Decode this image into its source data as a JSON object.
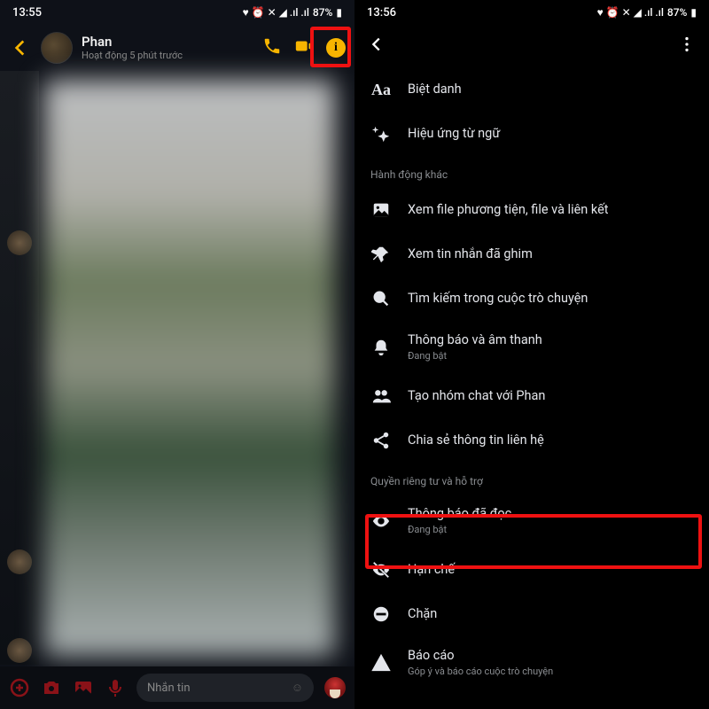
{
  "left": {
    "status_time": "13:55",
    "battery": "87%",
    "contact_name": "Phan",
    "last_active": "Hoạt động 5 phút trước",
    "compose_placeholder": "Nhắn tin"
  },
  "right": {
    "status_time": "13:56",
    "battery": "87%",
    "items_top": [
      {
        "icon": "aa",
        "label": "Biệt danh"
      },
      {
        "icon": "sparkle",
        "label": "Hiệu ứng từ ngữ"
      }
    ],
    "section_other": "Hành động khác",
    "items_other": [
      {
        "icon": "image",
        "label": "Xem file phương tiện, file và liên kết"
      },
      {
        "icon": "pin",
        "label": "Xem tin nhắn đã ghim"
      },
      {
        "icon": "search",
        "label": "Tìm kiếm trong cuộc trò chuyện"
      },
      {
        "icon": "bell",
        "label": "Thông báo và âm thanh",
        "sub": "Đang bật"
      },
      {
        "icon": "group",
        "label": "Tạo nhóm chat với Phan"
      },
      {
        "icon": "share",
        "label": "Chia sẻ thông tin liên hệ"
      }
    ],
    "section_privacy": "Quyền riêng tư và hỗ trợ",
    "items_privacy": [
      {
        "icon": "eye",
        "label": "Thông báo đã đọc",
        "sub": "Đang bật"
      },
      {
        "icon": "eye-off",
        "label": "Hạn chế"
      },
      {
        "icon": "block",
        "label": "Chặn"
      },
      {
        "icon": "warn",
        "label": "Báo cáo",
        "sub": "Góp ý và báo cáo cuộc trò chuyện"
      }
    ]
  }
}
